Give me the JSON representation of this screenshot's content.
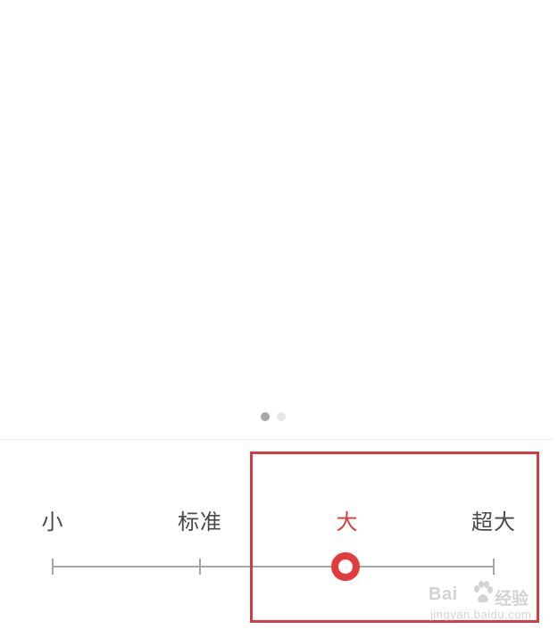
{
  "pager": {
    "total": 2,
    "active_index": 0
  },
  "font_size": {
    "options": [
      {
        "label": "小"
      },
      {
        "label": "标准"
      },
      {
        "label": "大"
      },
      {
        "label": "超大"
      }
    ],
    "selected_index": 2
  },
  "watermark": {
    "brand": "Bai",
    "brand_cn": "经验",
    "url": "jingyan.baidu.com"
  },
  "colors": {
    "accent": "#e23b3b",
    "highlight_border": "#d33c44",
    "text": "#4a4a4a",
    "track": "#a6a6a6"
  }
}
